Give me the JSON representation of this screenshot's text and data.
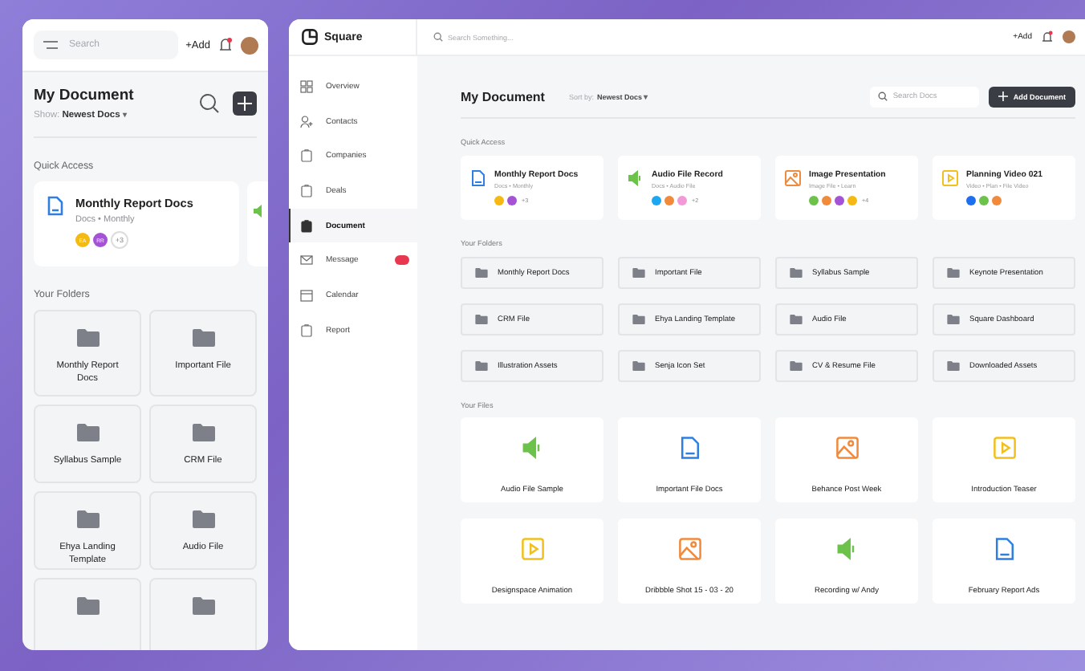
{
  "mobile": {
    "search": {
      "placeholder": "Search"
    },
    "add_label": "+Add",
    "notification": true,
    "title": "My Document",
    "show_label": "Show:",
    "show_value": "Newest Docs",
    "caret": "▾",
    "quick_access_label": "Quick Access",
    "quick_access": [
      {
        "kind": "doc",
        "title": "Monthly Report Docs",
        "subtitle": "Docs • Monthly",
        "avatars": [
          {
            "initials": "EA",
            "color": "#f5b914"
          },
          {
            "initials": "RR",
            "color": "#a553d6"
          }
        ],
        "more": "+3"
      }
    ],
    "peek_card": {
      "kind": "audio"
    },
    "folders_label": "Your Folders",
    "folders": [
      {
        "label": "Monthly Report Docs"
      },
      {
        "label": "Important File"
      },
      {
        "label": "Syllabus Sample"
      },
      {
        "label": "CRM File"
      },
      {
        "label": "Ehya Landing Template"
      },
      {
        "label": "Audio File"
      }
    ],
    "clipped_folders": [
      {
        "kind": "folder"
      },
      {
        "kind": "folder"
      }
    ]
  },
  "desktop": {
    "brand": "Square",
    "sidebar": [
      {
        "label": "Overview",
        "selected": false
      },
      {
        "label": "Contacts",
        "selected": false
      },
      {
        "label": "Companies",
        "selected": false
      },
      {
        "label": "Deals",
        "selected": false
      },
      {
        "label": "Document",
        "selected": true
      },
      {
        "label": "Message",
        "selected": false,
        "badge": true
      },
      {
        "label": "Calendar",
        "selected": false
      },
      {
        "label": "Report",
        "selected": false
      }
    ],
    "search": {
      "placeholder": "Search Something..."
    },
    "add_label": "+Add",
    "notification": true,
    "title": "My Document",
    "sort_label": "Sort by:",
    "sort_value": "Newest Docs",
    "caret": "▾",
    "search_docs": {
      "placeholder": "Search Docs"
    },
    "add_document": "Add Document",
    "quick_access_label": "Quick Access",
    "quick_access": [
      {
        "kind": "doc",
        "title": "Monthly Report Docs",
        "subtitle": "Docs • Monthly",
        "avatars": [
          {
            "color": "#f5b914"
          },
          {
            "color": "#a553d6"
          }
        ],
        "more": "+3"
      },
      {
        "kind": "audio",
        "title": "Audio File Record",
        "subtitle": "Docs • Audio File",
        "avatars": [
          {
            "color": "#1ea7f0"
          },
          {
            "color": "#f08a3c"
          },
          {
            "color": "#f29ad8"
          }
        ],
        "more": "+2"
      },
      {
        "kind": "image",
        "title": "Image Presentation",
        "subtitle": "Image File • Learn",
        "avatars": [
          {
            "color": "#6cc24a"
          },
          {
            "color": "#f08a3c"
          },
          {
            "color": "#a553d6"
          },
          {
            "color": "#f5b914"
          }
        ],
        "more": "+4"
      },
      {
        "kind": "video",
        "title": "Planning Video 021",
        "subtitle": "Video • Plan • File Video",
        "avatars": [
          {
            "color": "#1e6ff0"
          },
          {
            "color": "#6cc24a"
          },
          {
            "color": "#f08a3c"
          }
        ]
      }
    ],
    "folders_label": "Your Folders",
    "folders": [
      {
        "label": "Monthly Report Docs"
      },
      {
        "label": "Important File"
      },
      {
        "label": "Syllabus Sample"
      },
      {
        "label": "Keynote Presentation"
      },
      {
        "label": "CRM File"
      },
      {
        "label": "Ehya Landing Template"
      },
      {
        "label": "Audio File"
      },
      {
        "label": "Square Dashboard"
      },
      {
        "label": "Illustration Assets"
      },
      {
        "label": "Senja Icon Set"
      },
      {
        "label": "CV & Resume File"
      },
      {
        "label": "Downloaded Assets"
      }
    ],
    "files_label": "Your Files",
    "files": [
      {
        "kind": "audio",
        "label": "Audio File Sample"
      },
      {
        "kind": "doc",
        "label": "Important File Docs"
      },
      {
        "kind": "image",
        "label": "Behance Post Week"
      },
      {
        "kind": "video",
        "label": "Introduction Teaser"
      },
      {
        "kind": "video",
        "label": "Designspace Animation"
      },
      {
        "kind": "image",
        "label": "Dribbble Shot 15 - 03 - 20"
      },
      {
        "kind": "audio",
        "label": "Recording w/ Andy"
      },
      {
        "kind": "doc",
        "label": "February Report Ads"
      }
    ]
  }
}
